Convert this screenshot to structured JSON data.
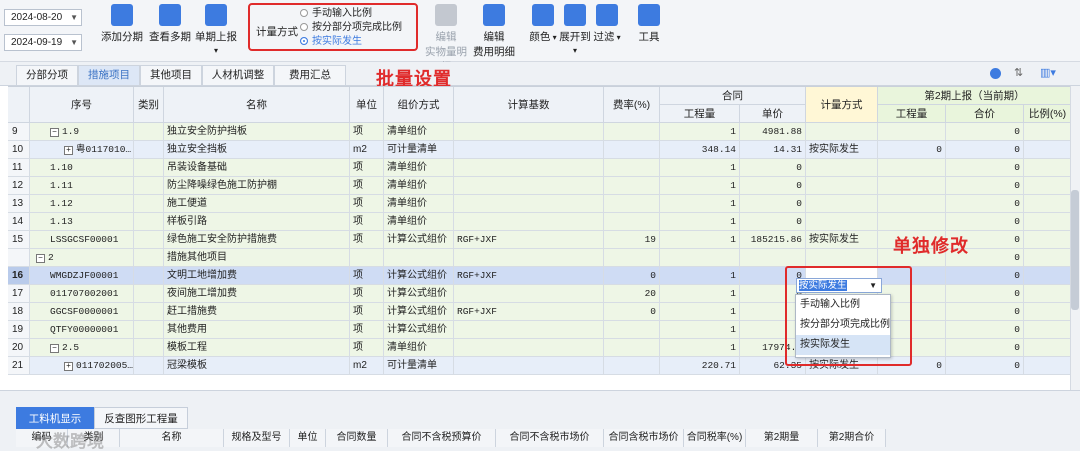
{
  "dates": {
    "start": "2024-08-20",
    "end": "2024-09-19"
  },
  "toolbar": {
    "buttons": [
      {
        "label": "添加分期",
        "icon": "add-period-icon"
      },
      {
        "label": "查看多期",
        "icon": "view-periods-icon"
      },
      {
        "label": "单期上报",
        "icon": "report-icon"
      },
      {
        "label": "编辑",
        "sub": "实物量明细",
        "icon": "edit-icon"
      },
      {
        "label": "编辑",
        "sub": "费用明细",
        "icon": "list-icon"
      },
      {
        "label": "颜色",
        "icon": "color-icon"
      },
      {
        "label": "展开到",
        "icon": "expand-icon"
      },
      {
        "label": "过滤",
        "icon": "filter-icon"
      },
      {
        "label": "工具",
        "icon": "tool-icon"
      }
    ],
    "calc_method": {
      "label": "计量方式",
      "options": [
        "手动输入比例",
        "按分部分项完成比例",
        "按实际发生"
      ],
      "selected": 2
    }
  },
  "tabs": [
    "分部分项",
    "措施项目",
    "其他项目",
    "人材机调整",
    "费用汇总"
  ],
  "active_tab": "措施项目",
  "annotations": {
    "batch": "批量设置",
    "single": "单独修改"
  },
  "headers": {
    "seq": "序号",
    "type": "类别",
    "name": "名称",
    "unit": "单位",
    "price_method": "组价方式",
    "calc_base": "计算基数",
    "rate": "费率(%)",
    "contract": "合同",
    "qty": "工程量",
    "price": "单价",
    "calc_method": "计量方式",
    "period2": "第2期上报（当前期）",
    "p2_qty": "工程量",
    "p2_price": "合价",
    "p2_ratio": "比例(%)"
  },
  "rows": [
    {
      "n": "9",
      "seq": "1.9",
      "exp": "−",
      "ind": 1,
      "name": "独立安全防护挡板",
      "unit": "项",
      "method": "清单组价",
      "base": "",
      "rate": "",
      "qty": "1",
      "price": "4981.88",
      "calc": "",
      "p2q": "",
      "p2p": "0",
      "p2r": "",
      "style": "green"
    },
    {
      "n": "10",
      "seq": "粤0117010…",
      "exp": "+",
      "ind": 2,
      "name": "独立安全挡板",
      "unit": "m2",
      "method": "可计量清单",
      "base": "",
      "rate": "",
      "qty": "348.14",
      "price": "14.31",
      "calc": "按实际发生",
      "p2q": "0",
      "p2p": "0",
      "p2r": "",
      "style": "blue"
    },
    {
      "n": "11",
      "seq": "1.10",
      "exp": "",
      "ind": 1,
      "name": "吊装设备基础",
      "unit": "项",
      "method": "清单组价",
      "base": "",
      "rate": "",
      "qty": "1",
      "price": "0",
      "calc": "",
      "p2q": "",
      "p2p": "0",
      "p2r": "",
      "style": "green"
    },
    {
      "n": "12",
      "seq": "1.11",
      "exp": "",
      "ind": 1,
      "name": "防尘降噪绿色施工防护棚",
      "unit": "项",
      "method": "清单组价",
      "base": "",
      "rate": "",
      "qty": "1",
      "price": "0",
      "calc": "",
      "p2q": "",
      "p2p": "0",
      "p2r": "",
      "style": "green"
    },
    {
      "n": "13",
      "seq": "1.12",
      "exp": "",
      "ind": 1,
      "name": "施工便道",
      "unit": "项",
      "method": "清单组价",
      "base": "",
      "rate": "",
      "qty": "1",
      "price": "0",
      "calc": "",
      "p2q": "",
      "p2p": "0",
      "p2r": "",
      "style": "green"
    },
    {
      "n": "14",
      "seq": "1.13",
      "exp": "",
      "ind": 1,
      "name": "样板引路",
      "unit": "项",
      "method": "清单组价",
      "base": "",
      "rate": "",
      "qty": "1",
      "price": "0",
      "calc": "",
      "p2q": "",
      "p2p": "0",
      "p2r": "",
      "style": "green"
    },
    {
      "n": "15",
      "seq": "LSSGCSF00001",
      "exp": "",
      "ind": 1,
      "name": "绿色施工安全防护措施费",
      "unit": "项",
      "method": "计算公式组价",
      "base": "RGF+JXF",
      "rate": "19",
      "qty": "1",
      "price": "185215.86",
      "calc": "按实际发生",
      "p2q": "",
      "p2p": "0",
      "p2r": "",
      "style": "green"
    },
    {
      "n": "",
      "seq": "2",
      "exp": "−",
      "ind": 0,
      "name": "措施其他项目",
      "unit": "",
      "method": "",
      "base": "",
      "rate": "",
      "qty": "",
      "price": "",
      "calc": "",
      "p2q": "",
      "p2p": "0",
      "p2r": "",
      "style": "green"
    },
    {
      "n": "16",
      "seq": "WMGDZJF00001",
      "exp": "",
      "ind": 1,
      "name": "文明工地增加费",
      "unit": "项",
      "method": "计算公式组价",
      "base": "RGF+JXF",
      "rate": "0",
      "qty": "1",
      "price": "0",
      "calc": "",
      "p2q": "",
      "p2p": "0",
      "p2r": "",
      "style": "sel"
    },
    {
      "n": "17",
      "seq": "011707002001",
      "exp": "",
      "ind": 1,
      "name": "夜间施工增加费",
      "unit": "项",
      "method": "计算公式组价",
      "base": "",
      "rate": "20",
      "qty": "1",
      "price": "0",
      "calc": "",
      "p2q": "",
      "p2p": "0",
      "p2r": "",
      "style": "green"
    },
    {
      "n": "18",
      "seq": "GGCSF0000001",
      "exp": "",
      "ind": 1,
      "name": "赶工措施费",
      "unit": "项",
      "method": "计算公式组价",
      "base": "RGF+JXF",
      "rate": "0",
      "qty": "1",
      "price": "0",
      "calc": "",
      "p2q": "",
      "p2p": "0",
      "p2r": "",
      "style": "green"
    },
    {
      "n": "19",
      "seq": "QTFY00000001",
      "exp": "",
      "ind": 1,
      "name": "其他费用",
      "unit": "项",
      "method": "计算公式组价",
      "base": "",
      "rate": "",
      "qty": "1",
      "price": "0",
      "calc": "",
      "p2q": "",
      "p2p": "0",
      "p2r": "",
      "style": "green"
    },
    {
      "n": "20",
      "seq": "2.5",
      "exp": "−",
      "ind": 1,
      "name": "模板工程",
      "unit": "项",
      "method": "清单组价",
      "base": "",
      "rate": "",
      "qty": "1",
      "price": "17974.3",
      "calc": "",
      "p2q": "",
      "p2p": "0",
      "p2r": "",
      "style": "green"
    },
    {
      "n": "21",
      "seq": "011702005…",
      "exp": "+",
      "ind": 2,
      "name": "冠梁模板",
      "unit": "m2",
      "method": "可计量清单",
      "base": "",
      "rate": "",
      "qty": "220.71",
      "price": "62.35",
      "calc": "按实际发生",
      "p2q": "0",
      "p2p": "0",
      "p2r": "",
      "style": "blue"
    }
  ],
  "dropdown": {
    "value": "按实际发生",
    "options": [
      "手动输入比例",
      "按分部分项完成比例",
      "按实际发生"
    ],
    "highlighted": 2
  },
  "bottom": {
    "tabs": [
      "工料机显示",
      "反查图形工程量"
    ],
    "headers": [
      "编码",
      "类别",
      "名称",
      "规格及型号",
      "单位",
      "合同数量",
      "合同不含税预算价",
      "合同不含税市场价",
      "合同含税市场价",
      "合同税率(%)",
      "第2期量",
      "第2期合价"
    ]
  },
  "watermark": "大数跨境",
  "colors": {
    "accent": "#3d7be0",
    "annotation": "#e02b2b",
    "row_green": "#eef6e6",
    "row_blue": "#e7eef9",
    "row_selected": "#cfdcf4"
  }
}
